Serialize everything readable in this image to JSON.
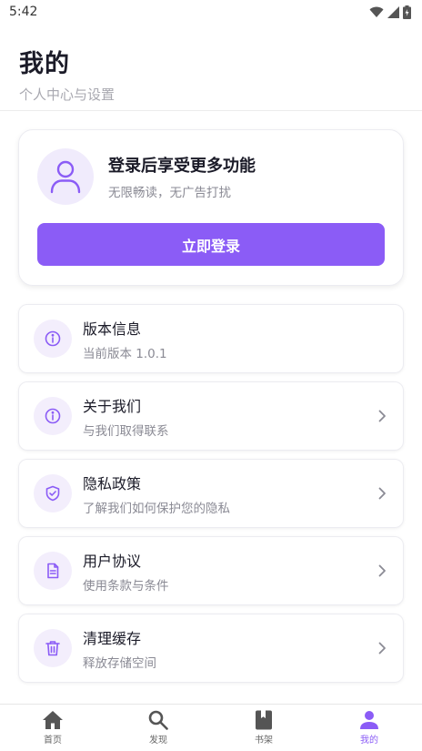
{
  "status_bar": {
    "time": "5:42"
  },
  "header": {
    "title": "我的",
    "subtitle": "个人中心与设置"
  },
  "login_card": {
    "title": "登录后享受更多功能",
    "desc": "无限畅读，无广告打扰",
    "button_label": "立即登录"
  },
  "menu": [
    {
      "title": "版本信息",
      "desc": "当前版本 1.0.1",
      "icon": "info-icon",
      "has_chevron": false
    },
    {
      "title": "关于我们",
      "desc": "与我们取得联系",
      "icon": "info-icon",
      "has_chevron": true
    },
    {
      "title": "隐私政策",
      "desc": "了解我们如何保护您的隐私",
      "icon": "shield-check-icon",
      "has_chevron": true
    },
    {
      "title": "用户协议",
      "desc": "使用条款与条件",
      "icon": "document-icon",
      "has_chevron": true
    },
    {
      "title": "清理缓存",
      "desc": "释放存储空间",
      "icon": "trash-icon",
      "has_chevron": true
    }
  ],
  "bottom_nav": [
    {
      "label": "首页",
      "icon": "home-icon",
      "active": false
    },
    {
      "label": "发现",
      "icon": "search-icon",
      "active": false
    },
    {
      "label": "书架",
      "icon": "book-icon",
      "active": false
    },
    {
      "label": "我的",
      "icon": "person-icon",
      "active": true
    }
  ],
  "colors": {
    "accent": "#8b5cf6",
    "accent_light": "#f0ebfc",
    "text_primary": "#1b1b28",
    "text_secondary": "#8a8a94"
  }
}
